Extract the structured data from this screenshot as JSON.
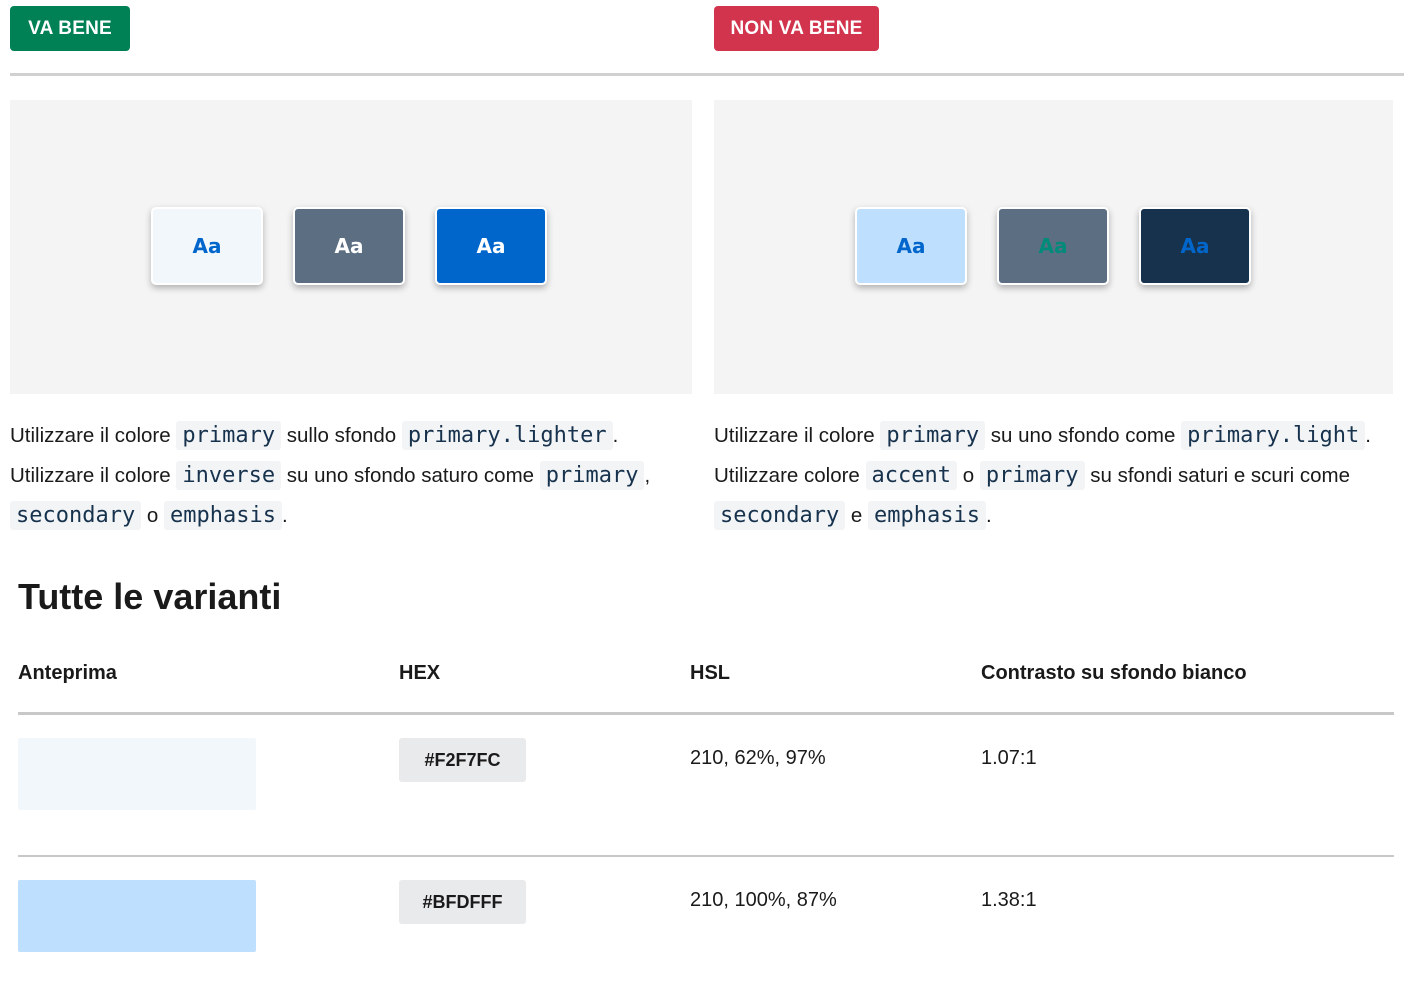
{
  "good": {
    "badge": "VA BENE",
    "swatches": [
      {
        "text": "Aa",
        "bg": "#F2F7FC",
        "fg": "#0066CC"
      },
      {
        "text": "Aa",
        "bg": "#5C6F82",
        "fg": "#FFFFFF"
      },
      {
        "text": "Aa",
        "bg": "#0066CC",
        "fg": "#FFFFFF"
      }
    ],
    "line1": {
      "a": "Utilizzare il colore",
      "c1": "primary",
      "b": "sullo sfondo",
      "c2": "primary.lighter",
      "end": "."
    },
    "line2": {
      "a": "Utilizzare il colore",
      "c1": "inverse",
      "b": "su uno sfondo saturo come",
      "c2": "primary",
      "end": ","
    },
    "line3": {
      "c1": "secondary",
      "b": "o",
      "c2": "emphasis",
      "end": "."
    }
  },
  "bad": {
    "badge": "NON VA BENE",
    "swatches": [
      {
        "text": "Aa",
        "bg": "#BFDFFF",
        "fg": "#0066CC"
      },
      {
        "text": "Aa",
        "bg": "#5C6F82",
        "fg": "#008A7A"
      },
      {
        "text": "Aa",
        "bg": "#17324D",
        "fg": "#0066CC"
      }
    ],
    "line1": {
      "a": "Utilizzare il colore",
      "c1": "primary",
      "b": "su uno sfondo come",
      "c2": "primary.light",
      "end": "."
    },
    "line2": {
      "a": "Utilizzare colore",
      "c1": "accent",
      "b": "o",
      "c2": "primary",
      "d": "su sfondi saturi e scuri come"
    },
    "line3": {
      "c1": "secondary",
      "b": "e",
      "c2": "emphasis",
      "end": "."
    }
  },
  "section": {
    "title": "Tutte le varianti"
  },
  "table": {
    "headers": [
      "Anteprima",
      "HEX",
      "HSL",
      "Contrasto su sfondo bianco"
    ],
    "rows": [
      {
        "color": "#F2F7FC",
        "hex": "#F2F7FC",
        "hsl": "210, 62%, 97%",
        "contrast": "1.07:1"
      },
      {
        "color": "#BFDFFF",
        "hex": "#BFDFFF",
        "hsl": "210, 100%, 87%",
        "contrast": "1.38:1"
      }
    ]
  }
}
